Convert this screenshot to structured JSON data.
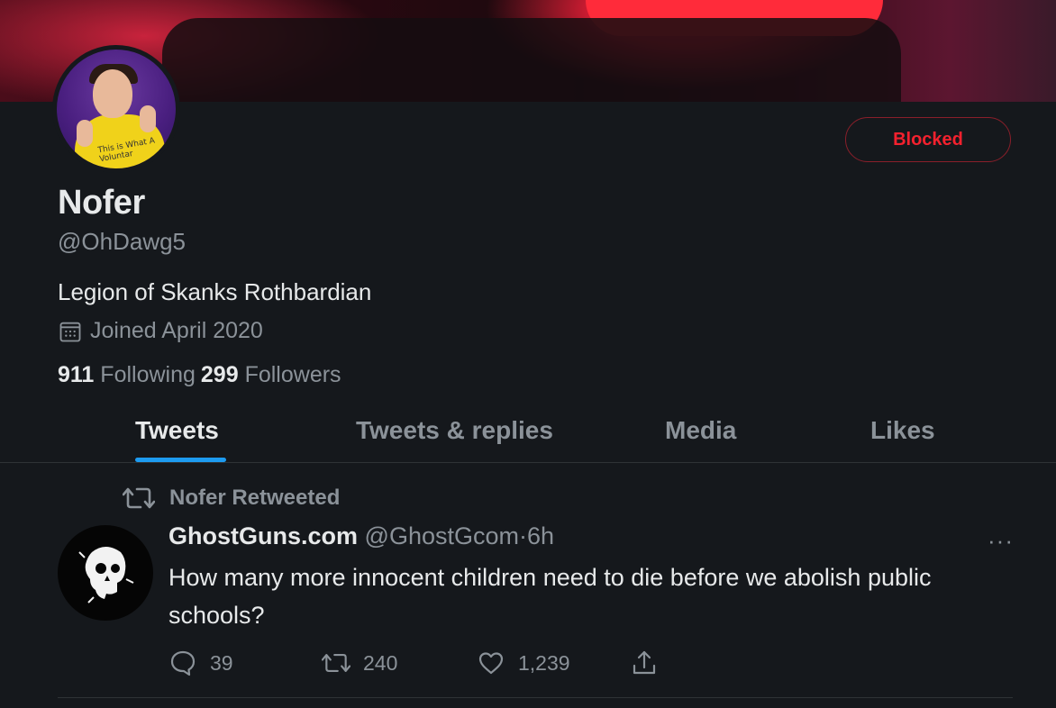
{
  "profile": {
    "display_name": "Nofer",
    "handle": "@OhDawg5",
    "bio": "Legion of Skanks Rothbardian",
    "joined": "Joined April 2020",
    "following_count": "911",
    "following_label": "Following",
    "followers_count": "299",
    "followers_label": "Followers",
    "blocked_label": "Blocked",
    "avatar_shirt_text": "This is What A Voluntar"
  },
  "tabs": [
    {
      "label": "Tweets",
      "active": true
    },
    {
      "label": "Tweets & replies",
      "active": false
    },
    {
      "label": "Media",
      "active": false
    },
    {
      "label": "Likes",
      "active": false
    }
  ],
  "tweet": {
    "retweet_label": "Nofer Retweeted",
    "author_name": "GhostGuns.com",
    "author_handle": "@GhostGcom",
    "separator": "·",
    "time": "6h",
    "text": "How many more innocent children need to die before we abolish public schools?",
    "more": "···",
    "reply_count": "39",
    "retweet_count": "240",
    "like_count": "1,239"
  },
  "icons": {
    "calendar": "calendar-icon",
    "retweet": "retweet-icon",
    "reply": "reply-icon",
    "like": "heart-icon",
    "share": "share-icon",
    "more": "more-icon"
  },
  "colors": {
    "background": "#15181c",
    "accent": "#1d9bf0",
    "blocked": "#f4212e",
    "muted": "#8b9299",
    "text": "#e7e9ea"
  }
}
